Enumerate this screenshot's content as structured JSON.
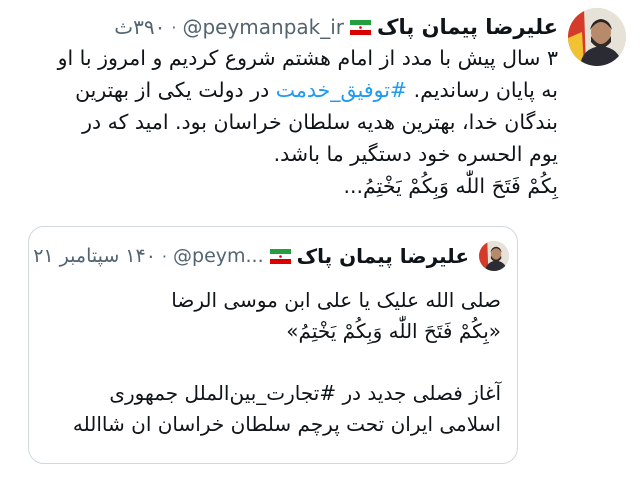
{
  "tweet": {
    "author_name": "علیرضا پیمان پاک",
    "flag_icon": "iran-flag-icon",
    "handle": "@peymanpak_ir",
    "time": "۳۹۰ث",
    "lines": [
      "۳ سال پیش با مدد از امام هشتم شروع کردیم و امروز با او",
      "به پایان رساندیم.",
      "#توفیق_خدمت",
      "در دولت یکی از بهترین",
      "بندگان خدا، بهترین هدیه سلطان خراسان بود. امید که در",
      "یوم الحسره خود دستگیر ما باشد.",
      "بِکُمْ فَتَحَ اللّٰه وَبِکُمْ یَخْتِمُ..."
    ]
  },
  "quote": {
    "author_name": "علیرضا پیمان پاک",
    "handle": "@peym...",
    "time": "۱۴۰ سپتامبر ۲۱",
    "lines": [
      "صلی الله علیک یا علی ابن موسی الرضا",
      "«بِکُمْ فَتَحَ اللّٰه وَبِکُمْ یَخْتِمُ»",
      "",
      "آغاز فصلی جدید در #تجارت_بین‌الملل جمهوری",
      "اسلامی ایران تحت پرچم سلطان خراسان ان شاالله"
    ]
  },
  "colors": {
    "link": "#1d9bf0",
    "secondary": "#536471",
    "border": "#cfd9de"
  }
}
